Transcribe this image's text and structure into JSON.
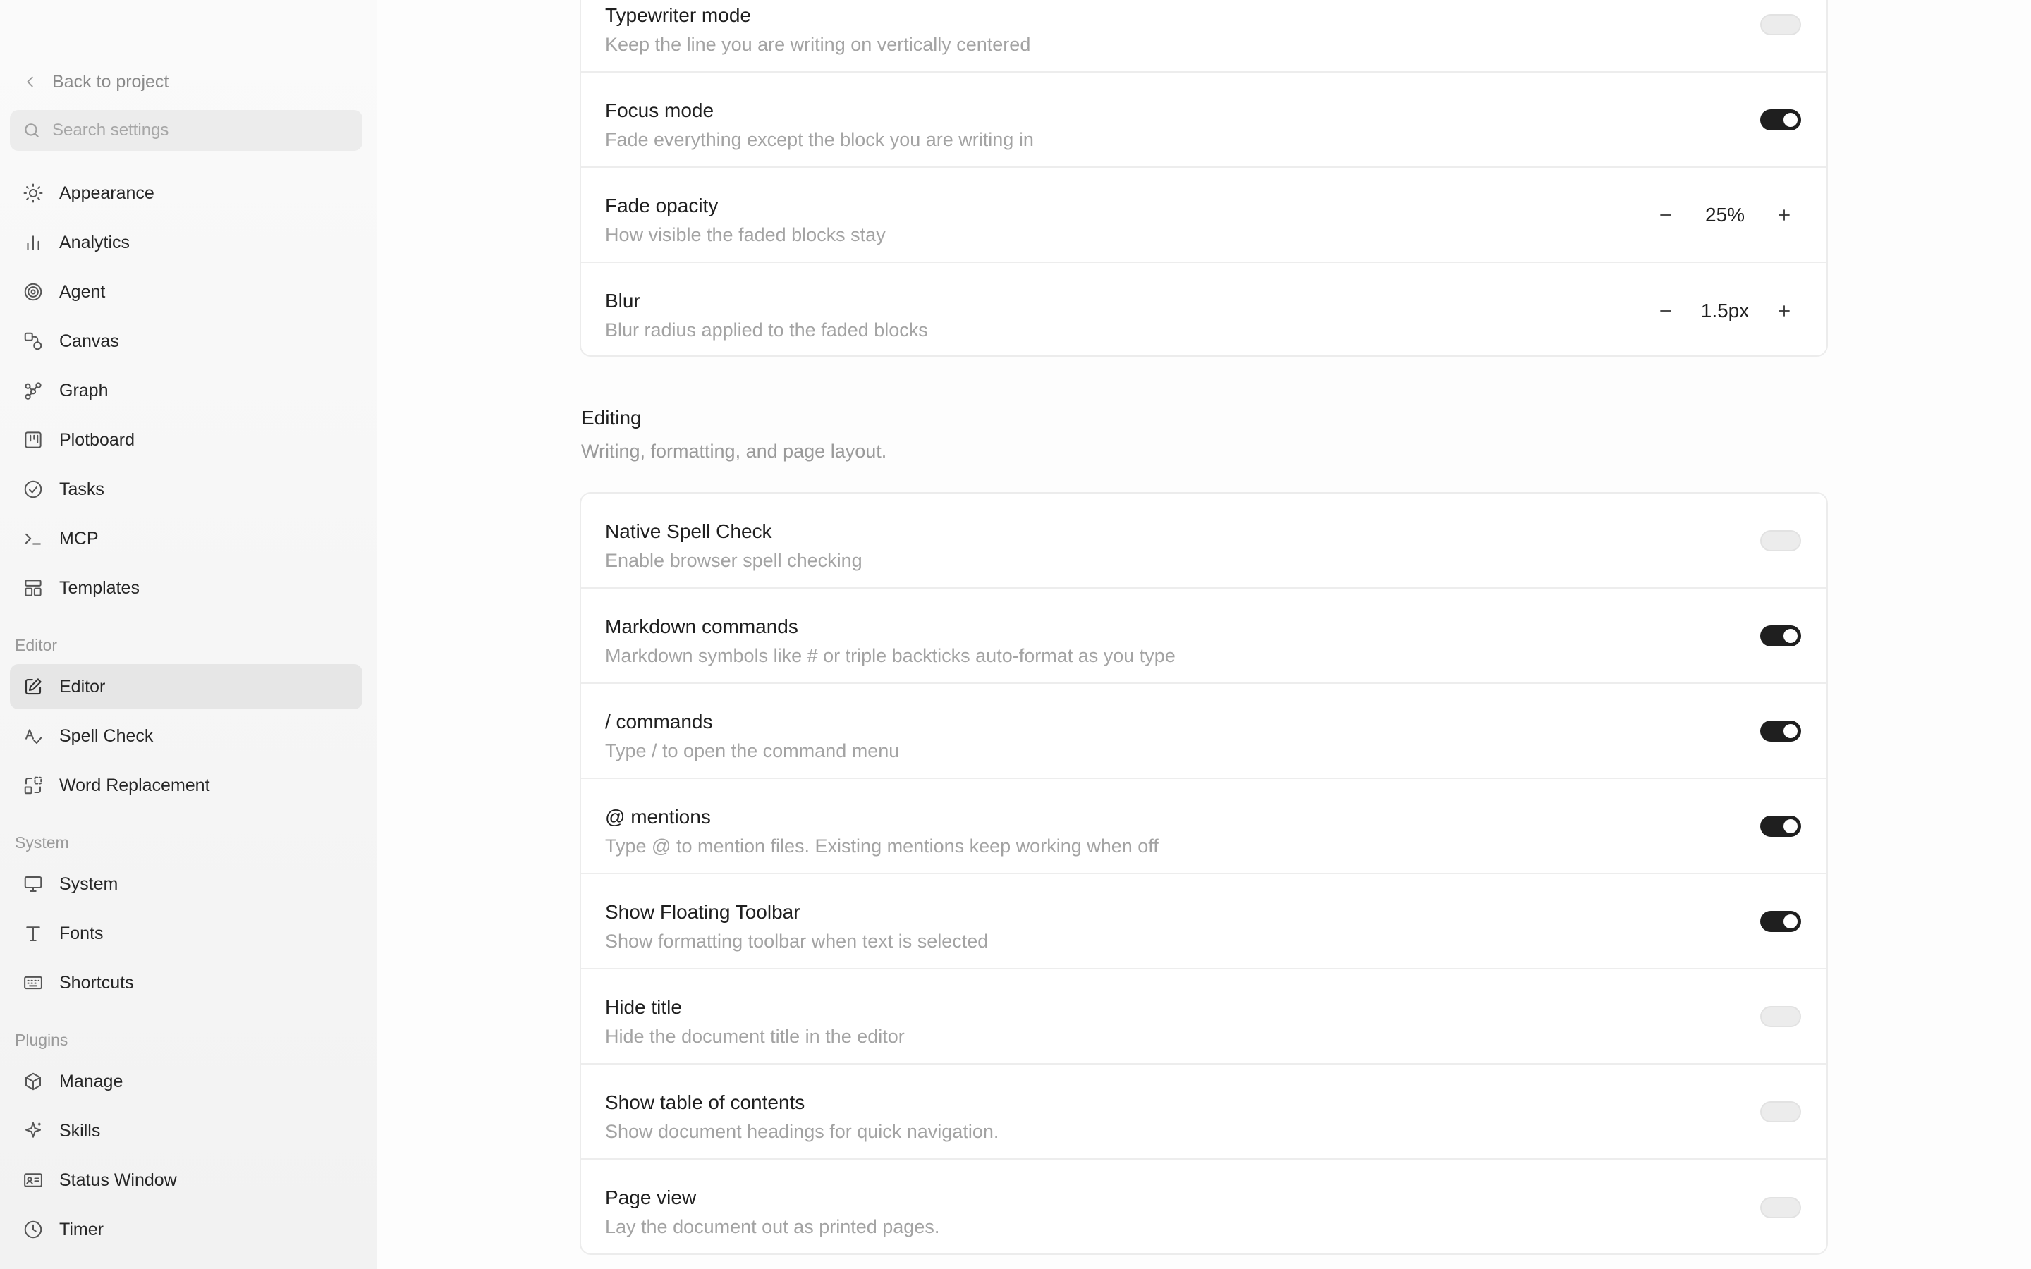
{
  "sidebar": {
    "back_label": "Back to project",
    "search_placeholder": "Search settings",
    "items_main": [
      {
        "label": "Appearance",
        "icon": "sun-icon"
      },
      {
        "label": "Analytics",
        "icon": "bar-chart-icon"
      },
      {
        "label": "Agent",
        "icon": "spiral-icon"
      },
      {
        "label": "Canvas",
        "icon": "shapes-icon"
      },
      {
        "label": "Graph",
        "icon": "graph-nodes-icon"
      },
      {
        "label": "Plotboard",
        "icon": "board-icon"
      },
      {
        "label": "Tasks",
        "icon": "check-circle-icon"
      },
      {
        "label": "MCP",
        "icon": "terminal-icon"
      },
      {
        "label": "Templates",
        "icon": "layout-icon"
      }
    ],
    "editor_section": "Editor",
    "items_editor": [
      {
        "label": "Editor",
        "icon": "edit-icon",
        "active": true
      },
      {
        "label": "Spell Check",
        "icon": "spell-check-icon"
      },
      {
        "label": "Word Replacement",
        "icon": "replace-icon"
      }
    ],
    "system_section": "System",
    "items_system": [
      {
        "label": "System",
        "icon": "monitor-icon"
      },
      {
        "label": "Fonts",
        "icon": "type-icon"
      },
      {
        "label": "Shortcuts",
        "icon": "keyboard-icon"
      }
    ],
    "plugins_section": "Plugins",
    "items_plugins": [
      {
        "label": "Manage",
        "icon": "package-icon"
      },
      {
        "label": "Skills",
        "icon": "sparkle-icon"
      },
      {
        "label": "Status Window",
        "icon": "id-card-icon"
      },
      {
        "label": "Timer",
        "icon": "clock-icon"
      }
    ]
  },
  "focus_card": {
    "rows": [
      {
        "title": "Typewriter mode",
        "desc": "Keep the line you are writing on vertically centered",
        "control": "toggle",
        "on": false
      },
      {
        "title": "Focus mode",
        "desc": "Fade everything except the block you are writing in",
        "control": "toggle",
        "on": true
      },
      {
        "title": "Fade opacity",
        "desc": "How visible the faded blocks stay",
        "control": "stepper",
        "value": "25%"
      },
      {
        "title": "Blur",
        "desc": "Blur radius applied to the faded blocks",
        "control": "stepper",
        "value": "1.5px"
      }
    ]
  },
  "editing": {
    "title": "Editing",
    "desc": "Writing, formatting, and page layout.",
    "rows": [
      {
        "title": "Native Spell Check",
        "desc": "Enable browser spell checking",
        "on": false
      },
      {
        "title": "Markdown commands",
        "desc": "Markdown symbols like # or triple backticks auto-format as you type",
        "on": true
      },
      {
        "title": "/ commands",
        "desc": "Type / to open the command menu",
        "on": true
      },
      {
        "title": "@ mentions",
        "desc": "Type @ to mention files. Existing mentions keep working when off",
        "on": true
      },
      {
        "title": "Show Floating Toolbar",
        "desc": "Show formatting toolbar when text is selected",
        "on": true
      },
      {
        "title": "Hide title",
        "desc": "Hide the document title in the editor",
        "on": false
      },
      {
        "title": "Show table of contents",
        "desc": "Show document headings for quick navigation.",
        "on": false
      },
      {
        "title": "Page view",
        "desc": "Lay the document out as printed pages.",
        "on": false
      }
    ]
  }
}
